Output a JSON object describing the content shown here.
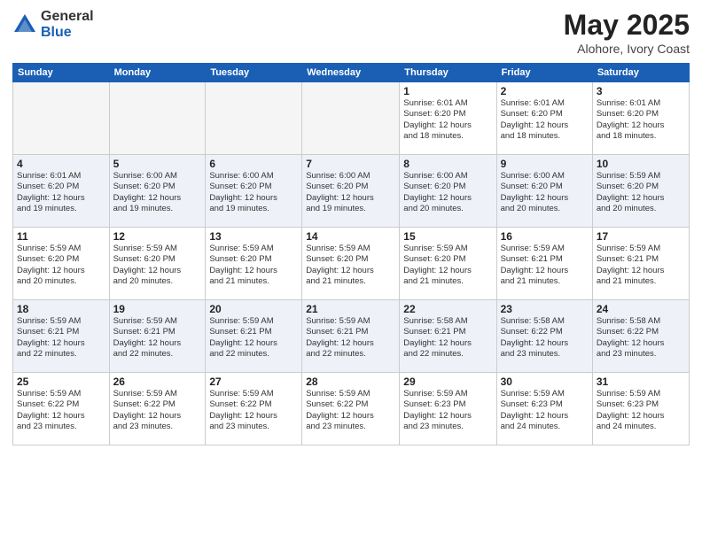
{
  "header": {
    "logo_general": "General",
    "logo_blue": "Blue",
    "month": "May 2025",
    "location": "Alohore, Ivory Coast"
  },
  "weekdays": [
    "Sunday",
    "Monday",
    "Tuesday",
    "Wednesday",
    "Thursday",
    "Friday",
    "Saturday"
  ],
  "weeks": [
    [
      {
        "day": "",
        "info": ""
      },
      {
        "day": "",
        "info": ""
      },
      {
        "day": "",
        "info": ""
      },
      {
        "day": "",
        "info": ""
      },
      {
        "day": "1",
        "info": "Sunrise: 6:01 AM\nSunset: 6:20 PM\nDaylight: 12 hours\nand 18 minutes."
      },
      {
        "day": "2",
        "info": "Sunrise: 6:01 AM\nSunset: 6:20 PM\nDaylight: 12 hours\nand 18 minutes."
      },
      {
        "day": "3",
        "info": "Sunrise: 6:01 AM\nSunset: 6:20 PM\nDaylight: 12 hours\nand 18 minutes."
      }
    ],
    [
      {
        "day": "4",
        "info": "Sunrise: 6:01 AM\nSunset: 6:20 PM\nDaylight: 12 hours\nand 19 minutes."
      },
      {
        "day": "5",
        "info": "Sunrise: 6:00 AM\nSunset: 6:20 PM\nDaylight: 12 hours\nand 19 minutes."
      },
      {
        "day": "6",
        "info": "Sunrise: 6:00 AM\nSunset: 6:20 PM\nDaylight: 12 hours\nand 19 minutes."
      },
      {
        "day": "7",
        "info": "Sunrise: 6:00 AM\nSunset: 6:20 PM\nDaylight: 12 hours\nand 19 minutes."
      },
      {
        "day": "8",
        "info": "Sunrise: 6:00 AM\nSunset: 6:20 PM\nDaylight: 12 hours\nand 20 minutes."
      },
      {
        "day": "9",
        "info": "Sunrise: 6:00 AM\nSunset: 6:20 PM\nDaylight: 12 hours\nand 20 minutes."
      },
      {
        "day": "10",
        "info": "Sunrise: 5:59 AM\nSunset: 6:20 PM\nDaylight: 12 hours\nand 20 minutes."
      }
    ],
    [
      {
        "day": "11",
        "info": "Sunrise: 5:59 AM\nSunset: 6:20 PM\nDaylight: 12 hours\nand 20 minutes."
      },
      {
        "day": "12",
        "info": "Sunrise: 5:59 AM\nSunset: 6:20 PM\nDaylight: 12 hours\nand 20 minutes."
      },
      {
        "day": "13",
        "info": "Sunrise: 5:59 AM\nSunset: 6:20 PM\nDaylight: 12 hours\nand 21 minutes."
      },
      {
        "day": "14",
        "info": "Sunrise: 5:59 AM\nSunset: 6:20 PM\nDaylight: 12 hours\nand 21 minutes."
      },
      {
        "day": "15",
        "info": "Sunrise: 5:59 AM\nSunset: 6:20 PM\nDaylight: 12 hours\nand 21 minutes."
      },
      {
        "day": "16",
        "info": "Sunrise: 5:59 AM\nSunset: 6:21 PM\nDaylight: 12 hours\nand 21 minutes."
      },
      {
        "day": "17",
        "info": "Sunrise: 5:59 AM\nSunset: 6:21 PM\nDaylight: 12 hours\nand 21 minutes."
      }
    ],
    [
      {
        "day": "18",
        "info": "Sunrise: 5:59 AM\nSunset: 6:21 PM\nDaylight: 12 hours\nand 22 minutes."
      },
      {
        "day": "19",
        "info": "Sunrise: 5:59 AM\nSunset: 6:21 PM\nDaylight: 12 hours\nand 22 minutes."
      },
      {
        "day": "20",
        "info": "Sunrise: 5:59 AM\nSunset: 6:21 PM\nDaylight: 12 hours\nand 22 minutes."
      },
      {
        "day": "21",
        "info": "Sunrise: 5:59 AM\nSunset: 6:21 PM\nDaylight: 12 hours\nand 22 minutes."
      },
      {
        "day": "22",
        "info": "Sunrise: 5:58 AM\nSunset: 6:21 PM\nDaylight: 12 hours\nand 22 minutes."
      },
      {
        "day": "23",
        "info": "Sunrise: 5:58 AM\nSunset: 6:22 PM\nDaylight: 12 hours\nand 23 minutes."
      },
      {
        "day": "24",
        "info": "Sunrise: 5:58 AM\nSunset: 6:22 PM\nDaylight: 12 hours\nand 23 minutes."
      }
    ],
    [
      {
        "day": "25",
        "info": "Sunrise: 5:59 AM\nSunset: 6:22 PM\nDaylight: 12 hours\nand 23 minutes."
      },
      {
        "day": "26",
        "info": "Sunrise: 5:59 AM\nSunset: 6:22 PM\nDaylight: 12 hours\nand 23 minutes."
      },
      {
        "day": "27",
        "info": "Sunrise: 5:59 AM\nSunset: 6:22 PM\nDaylight: 12 hours\nand 23 minutes."
      },
      {
        "day": "28",
        "info": "Sunrise: 5:59 AM\nSunset: 6:22 PM\nDaylight: 12 hours\nand 23 minutes."
      },
      {
        "day": "29",
        "info": "Sunrise: 5:59 AM\nSunset: 6:23 PM\nDaylight: 12 hours\nand 23 minutes."
      },
      {
        "day": "30",
        "info": "Sunrise: 5:59 AM\nSunset: 6:23 PM\nDaylight: 12 hours\nand 24 minutes."
      },
      {
        "day": "31",
        "info": "Sunrise: 5:59 AM\nSunset: 6:23 PM\nDaylight: 12 hours\nand 24 minutes."
      }
    ]
  ]
}
